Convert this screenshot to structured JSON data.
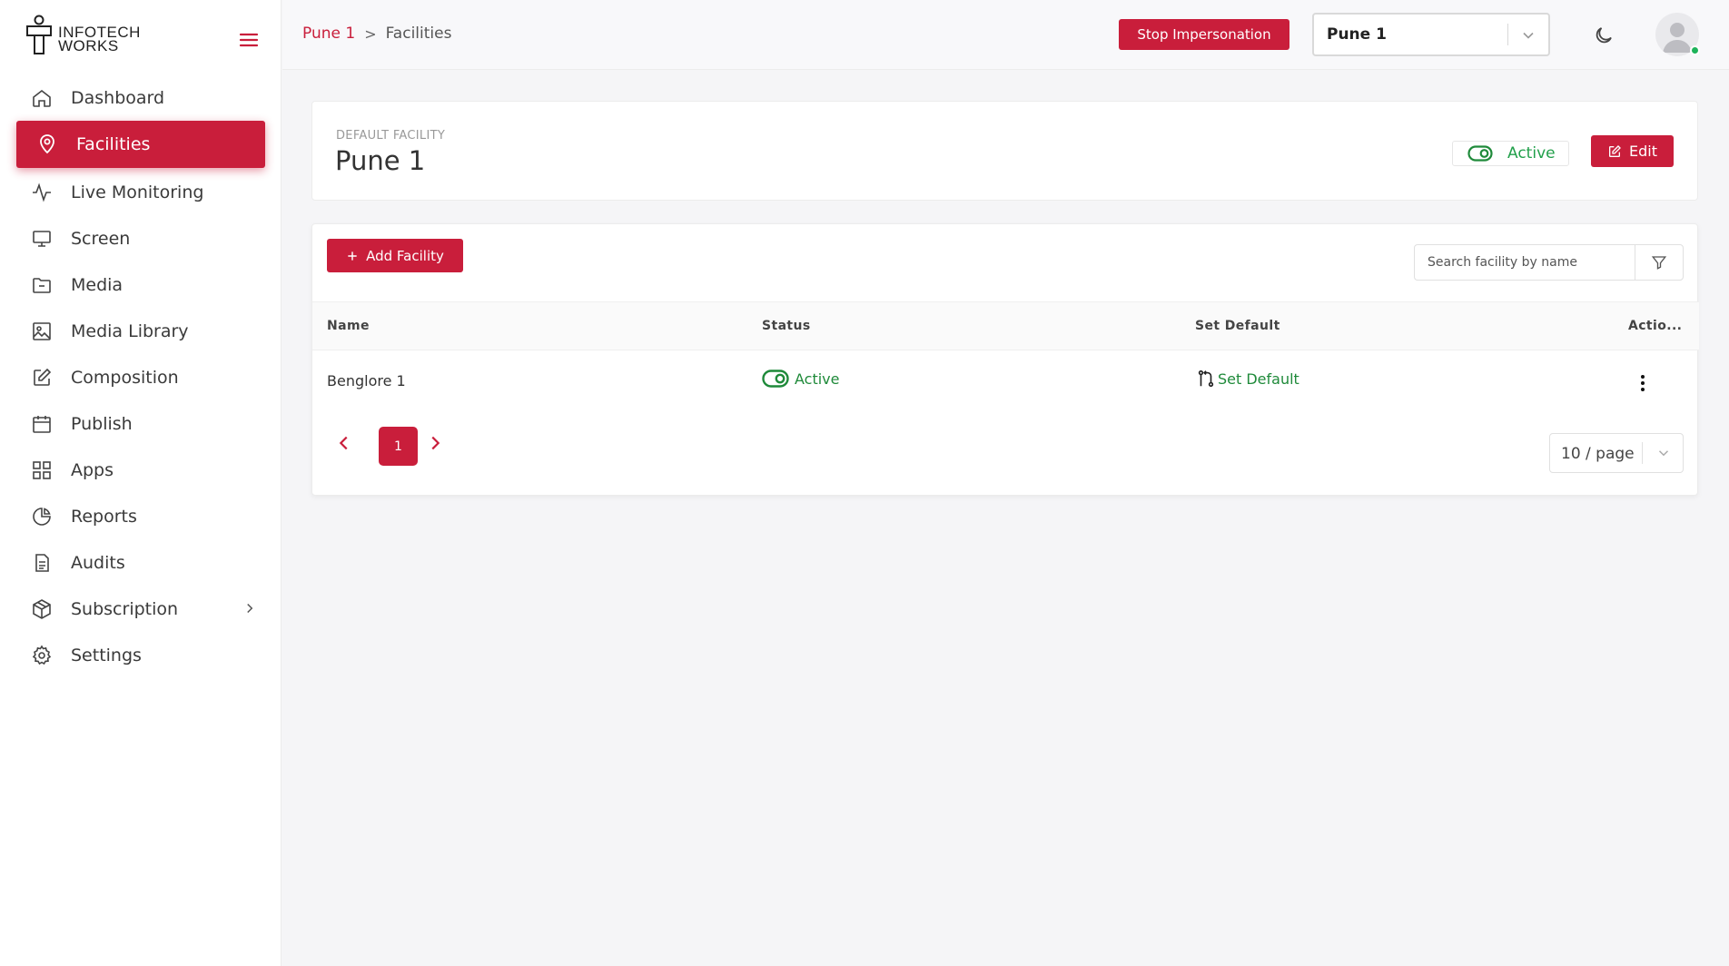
{
  "brand": {
    "line1": "INFOTECH",
    "line2": "WORKS",
    "accent": "#c91e3b"
  },
  "sidebar": {
    "items": [
      {
        "label": "Dashboard",
        "icon": "home-icon"
      },
      {
        "label": "Facilities",
        "icon": "location-pin-icon",
        "active": true
      },
      {
        "label": "Live Monitoring",
        "icon": "pulse-icon"
      },
      {
        "label": "Screen",
        "icon": "monitor-icon"
      },
      {
        "label": "Media",
        "icon": "folder-icon"
      },
      {
        "label": "Media Library",
        "icon": "image-icon"
      },
      {
        "label": "Composition",
        "icon": "edit-icon"
      },
      {
        "label": "Publish",
        "icon": "calendar-icon"
      },
      {
        "label": "Apps",
        "icon": "grid-icon"
      },
      {
        "label": "Reports",
        "icon": "pie-chart-icon"
      },
      {
        "label": "Audits",
        "icon": "document-icon"
      },
      {
        "label": "Subscription",
        "icon": "package-icon",
        "has_children": true
      },
      {
        "label": "Settings",
        "icon": "gear-icon"
      }
    ]
  },
  "header": {
    "breadcrumb": {
      "parent": "Pune 1",
      "separator": ">",
      "current": "Facilities"
    },
    "stop_impersonation_label": "Stop Impersonation",
    "facility_select_value": "Pune 1"
  },
  "default_facility": {
    "label": "DEFAULT FACILITY",
    "name": "Pune 1",
    "status": "Active",
    "edit_label": "Edit"
  },
  "facilities_table": {
    "add_label": "Add Facility",
    "search_placeholder": "Search facility by name",
    "columns": [
      "Name",
      "Status",
      "Set Default",
      "Actio..."
    ],
    "rows": [
      {
        "name": "Benglore 1",
        "status": "Active",
        "set_default": "Set Default"
      }
    ],
    "pagination": {
      "current_page": "1",
      "page_size": "10 / page"
    }
  },
  "colors": {
    "primary": "#c91e3b",
    "success": "#22a04b",
    "online": "#1eb35a"
  }
}
